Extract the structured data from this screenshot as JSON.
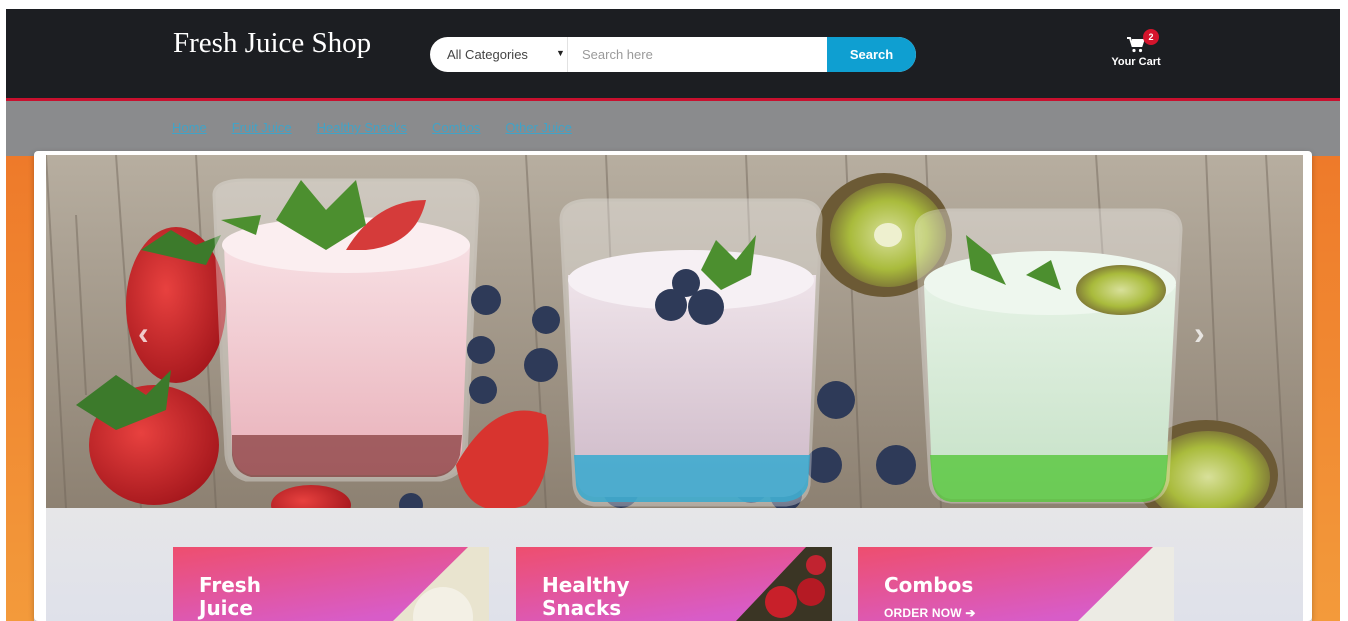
{
  "header": {
    "brand": "Fresh Juice Shop",
    "category_selected": "All Categories",
    "search_placeholder": "Search here",
    "search_button": "Search",
    "cart_count": "2",
    "cart_label": "Your Cart"
  },
  "nav": {
    "links": [
      "Home",
      "Fruit Juice",
      "Healthy Snacks",
      "Combos",
      "Other Juice"
    ]
  },
  "slider": {
    "prev_icon": "chevron-left-icon",
    "next_icon": "chevron-right-icon"
  },
  "promos": [
    {
      "line1": "Fresh",
      "line2": "Juice",
      "cta": ""
    },
    {
      "line1": "Healthy",
      "line2": "Snacks",
      "cta": ""
    },
    {
      "line1": "Combos",
      "line2": "",
      "cta": "ORDER NOW ➔"
    }
  ],
  "colors": {
    "header_bg": "#1c1e22",
    "accent_blue": "#0f9fd1",
    "badge_red": "#d4142c",
    "promo_pink": "#ea4c78",
    "promo_magenta": "#d85cc8",
    "orange": "#ee7a2a"
  }
}
